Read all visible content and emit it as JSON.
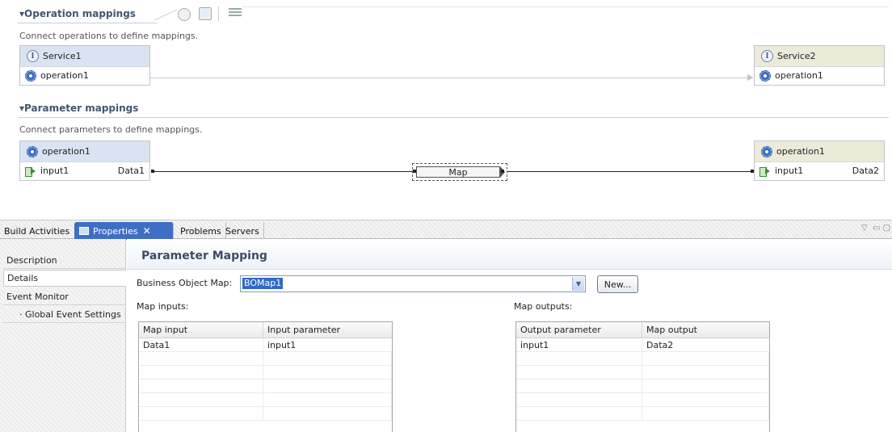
{
  "operation_mappings": {
    "title": "▾Operation mappings",
    "description": "Connect operations to define mappings.",
    "source": {
      "interface_glyph": "I",
      "name": "Service1",
      "operation": "operation1"
    },
    "target": {
      "interface_glyph": "I",
      "name": "Service2",
      "operation": "operation1"
    }
  },
  "parameter_mappings": {
    "title": "▾Parameter mappings",
    "description": "Connect parameters to define mappings.",
    "source": {
      "operation": "operation1",
      "param": "input1",
      "type": "Data1"
    },
    "target": {
      "operation": "operation1",
      "param": "input1",
      "type": "Data2"
    },
    "map_node_label": "Map"
  },
  "tabs": [
    {
      "label": "Build Activities"
    },
    {
      "label": "Properties"
    },
    {
      "label": "Problems"
    },
    {
      "label": "Servers"
    }
  ],
  "close_glyph": "✕",
  "window_controls": {
    "minimize": "▽",
    "restore": "▭ ▢"
  },
  "sidebar": {
    "items": [
      {
        "label": "Description"
      },
      {
        "label": "Details"
      },
      {
        "label": "Event Monitor"
      },
      {
        "label": "· Global Event Settings"
      }
    ]
  },
  "panel": {
    "title": "Parameter Mapping",
    "bo_map_label": "Business Object Map:",
    "bo_map_value": "BOMap1",
    "dropdown_glyph": "▼",
    "new_button": "New...",
    "inputs_label": "Map inputs:",
    "outputs_label": "Map outputs:",
    "inputs_table": {
      "headers": [
        "Map input",
        "Input parameter"
      ],
      "rows": [
        [
          "Data1",
          "input1"
        ]
      ]
    },
    "outputs_table": {
      "headers": [
        "Output parameter",
        "Map output"
      ],
      "rows": [
        [
          "input1",
          "Data2"
        ]
      ]
    }
  }
}
